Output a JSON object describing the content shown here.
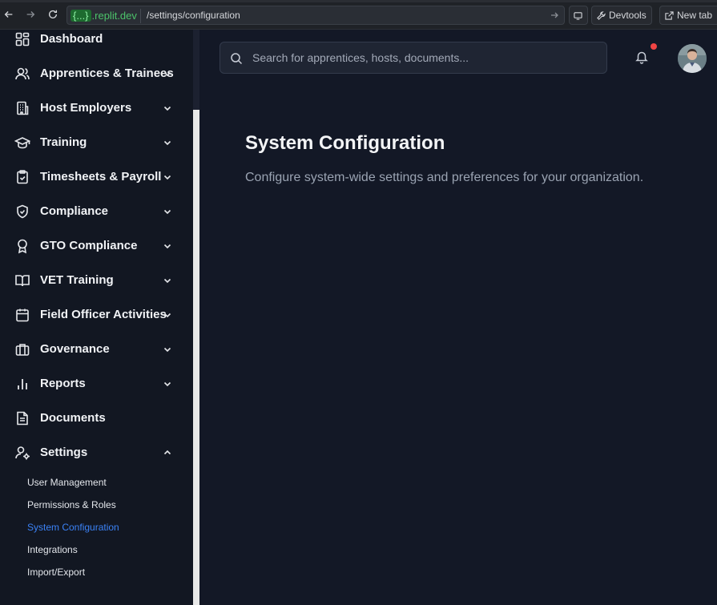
{
  "browser": {
    "url_host_pill": "{...}",
    "url_host": ".replit.dev",
    "url_path": "/settings/configuration",
    "devtools_label": "Devtools",
    "new_tab_label": "New tab"
  },
  "sidebar": {
    "items": [
      {
        "label": "Dashboard",
        "icon": "dashboard-icon"
      },
      {
        "label": "Apprentices & Trainees",
        "icon": "users-icon"
      },
      {
        "label": "Host Employers",
        "icon": "building-icon"
      },
      {
        "label": "Training",
        "icon": "graduation-cap-icon"
      },
      {
        "label": "Timesheets & Payroll",
        "icon": "clipboard-check-icon"
      },
      {
        "label": "Compliance",
        "icon": "shield-check-icon"
      },
      {
        "label": "GTO Compliance",
        "icon": "award-icon"
      },
      {
        "label": "VET Training",
        "icon": "book-open-icon"
      },
      {
        "label": "Field Officer Activities",
        "icon": "calendar-icon"
      },
      {
        "label": "Governance",
        "icon": "briefcase-icon"
      },
      {
        "label": "Reports",
        "icon": "bar-chart-icon"
      },
      {
        "label": "Documents",
        "icon": "file-text-icon"
      },
      {
        "label": "Settings",
        "icon": "user-cog-icon"
      }
    ],
    "settings_sub_items": [
      {
        "label": "User Management"
      },
      {
        "label": "Permissions & Roles"
      },
      {
        "label": "System Configuration",
        "active": true
      },
      {
        "label": "Integrations"
      },
      {
        "label": "Import/Export"
      }
    ]
  },
  "header": {
    "search_placeholder": "Search for apprentices, hosts, documents...",
    "search_value": ""
  },
  "main": {
    "title": "System Configuration",
    "description": "Configure system-wide settings and preferences for your organization."
  },
  "colors": {
    "background": "#131826",
    "sidebar": "#121722",
    "accent": "#3b82f6",
    "notification": "#ef4444"
  }
}
